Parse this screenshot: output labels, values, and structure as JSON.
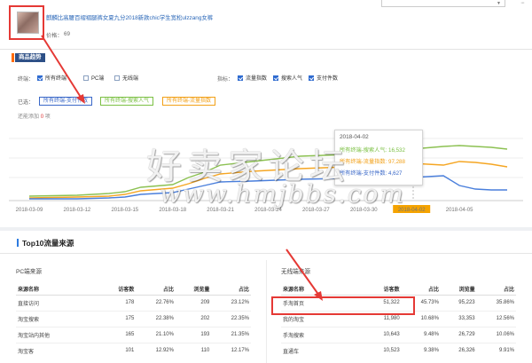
{
  "product": {
    "title": "麒麟比高腰百褶褶腿裤女夏九分2018新款chic学生宽松ulzzang女裤",
    "price_label": "价格：",
    "price_value": "69"
  },
  "trend": {
    "heading": "商品趋势",
    "terminal_label": "终端：",
    "terminal_options": [
      {
        "label": "所有终端",
        "checked": true
      },
      {
        "label": "PC端",
        "checked": false
      },
      {
        "label": "无线端",
        "checked": false
      }
    ],
    "metric_label": "指标：",
    "metric_options": [
      {
        "label": "流量指数",
        "checked": true
      },
      {
        "label": "搜索人气",
        "checked": true
      },
      {
        "label": "支付件数",
        "checked": true
      }
    ],
    "selected_label": "已选：",
    "selected_tags": [
      "所有终端-支付件数",
      "所有终端-搜索人气",
      "所有终端-流量指数"
    ],
    "compare_text": "还能添加",
    "compare_count": "0",
    "compare_unit": "项"
  },
  "chart_data": {
    "type": "line",
    "x": [
      "2018-03-09",
      "2018-03-12",
      "2018-03-15",
      "2018-03-18",
      "2018-03-21",
      "2018-03-24",
      "2018-03-27",
      "2018-03-30",
      "2018-04-02",
      "2018-04-05"
    ],
    "highlight_x": "2018-04-02",
    "series": [
      {
        "name": "所有终端-搜索人气",
        "color": "#8cc152"
      },
      {
        "name": "所有终端-流量指数",
        "color": "#f5a623"
      },
      {
        "name": "所有终端-支付件数",
        "color": "#4a7fdc"
      }
    ],
    "tooltip": {
      "date": "2018-04-02",
      "rows": [
        {
          "label": "所有终端-搜索人气",
          "value": "16,532",
          "color": "#7bc043"
        },
        {
          "label": "所有终端-流量指数",
          "value": "97,288",
          "color": "#f2a017"
        },
        {
          "label": "所有终端-支付件数",
          "value": "4,627",
          "color": "#3a68c8"
        }
      ]
    }
  },
  "sources": {
    "title": "Top10流量来源",
    "pc": {
      "title": "PC端来源",
      "headers": [
        "来源名称",
        "访客数",
        "占比",
        "浏览量",
        "占比"
      ],
      "rows": [
        [
          "直接访问",
          "178",
          "22.76%",
          "209",
          "23.12%"
        ],
        [
          "淘宝搜索",
          "175",
          "22.38%",
          "202",
          "22.35%"
        ],
        [
          "淘宝站内其他",
          "165",
          "21.10%",
          "193",
          "21.35%"
        ],
        [
          "淘宝客",
          "101",
          "12.92%",
          "110",
          "12.17%"
        ]
      ]
    },
    "wireless": {
      "title": "无线端来源",
      "headers": [
        "来源名称",
        "访客数",
        "占比",
        "浏览量",
        "占比"
      ],
      "rows": [
        [
          "手淘首页",
          "51,322",
          "45.73%",
          "95,223",
          "35.86%"
        ],
        [
          "我的淘宝",
          "11,980",
          "10.68%",
          "33,353",
          "12.56%"
        ],
        [
          "手淘搜索",
          "10,643",
          "9.48%",
          "26,729",
          "10.06%"
        ],
        [
          "直通车",
          "10,523",
          "9.38%",
          "26,326",
          "9.91%"
        ]
      ]
    }
  },
  "watermark": {
    "text": "好卖家论坛",
    "url": "www.hmjbbs.com"
  }
}
